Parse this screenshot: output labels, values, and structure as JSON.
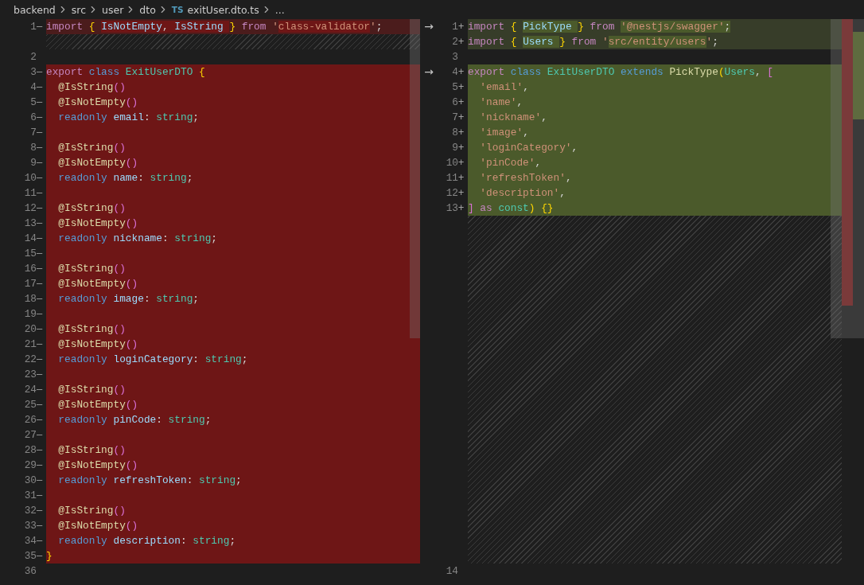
{
  "breadcrumb": [
    {
      "text": "backend"
    },
    {
      "text": "src"
    },
    {
      "text": "user"
    },
    {
      "text": "dto"
    },
    {
      "text": "exitUser.dto.ts",
      "badge": "TS"
    },
    {
      "text": "..."
    }
  ],
  "left_pane": {
    "rows": [
      {
        "kind": "modified",
        "number": "1",
        "marker": "—",
        "segments": [
          {
            "highlight": false,
            "tokens": [
              {
                "kind": "keyword",
                "text": "import "
              },
              {
                "kind": "bracket",
                "text": "{ "
              }
            ]
          },
          {
            "highlight": true,
            "tokens": [
              {
                "kind": "variable",
                "text": "IsNotEmpty"
              },
              {
                "kind": "punct",
                "text": ", "
              },
              {
                "kind": "variable",
                "text": "IsString "
              }
            ]
          },
          {
            "highlight": false,
            "tokens": [
              {
                "kind": "bracket",
                "text": "} "
              },
              {
                "kind": "keyword",
                "text": "from "
              },
              {
                "kind": "string",
                "text": "'"
              }
            ]
          },
          {
            "highlight": true,
            "tokens": [
              {
                "kind": "string",
                "text": "class-validator"
              }
            ]
          },
          {
            "highlight": false,
            "tokens": [
              {
                "kind": "string",
                "text": "'"
              },
              {
                "kind": "punct",
                "text": ";"
              }
            ]
          }
        ]
      },
      {
        "kind": "filler"
      },
      {
        "kind": "unchanged",
        "number": "2"
      },
      {
        "kind": "removed",
        "number": "3",
        "marker": "—",
        "tokens": [
          {
            "kind": "keyword",
            "text": "export "
          },
          {
            "kind": "storage",
            "text": "class "
          },
          {
            "kind": "type",
            "text": "ExitUserDTO "
          },
          {
            "kind": "bracket",
            "text": "{"
          }
        ]
      },
      {
        "kind": "removed",
        "number": "4",
        "marker": "—",
        "tokens": [
          {
            "kind": "function",
            "text": "  @IsString"
          },
          {
            "kind": "paren",
            "text": "()"
          }
        ]
      },
      {
        "kind": "removed",
        "number": "5",
        "marker": "—",
        "tokens": [
          {
            "kind": "function",
            "text": "  @IsNotEmpty"
          },
          {
            "kind": "paren",
            "text": "()"
          }
        ]
      },
      {
        "kind": "removed",
        "number": "6",
        "marker": "—",
        "tokens": [
          {
            "kind": "storage",
            "text": "  readonly "
          },
          {
            "kind": "variable",
            "text": "email"
          },
          {
            "kind": "punct",
            "text": ": "
          },
          {
            "kind": "type",
            "text": "string"
          },
          {
            "kind": "punct",
            "text": ";"
          }
        ]
      },
      {
        "kind": "removed",
        "number": "7",
        "marker": "—"
      },
      {
        "kind": "removed",
        "number": "8",
        "marker": "—",
        "tokens": [
          {
            "kind": "function",
            "text": "  @IsString"
          },
          {
            "kind": "paren",
            "text": "()"
          }
        ]
      },
      {
        "kind": "removed",
        "number": "9",
        "marker": "—",
        "tokens": [
          {
            "kind": "function",
            "text": "  @IsNotEmpty"
          },
          {
            "kind": "paren",
            "text": "()"
          }
        ]
      },
      {
        "kind": "removed",
        "number": "10",
        "marker": "—",
        "tokens": [
          {
            "kind": "storage",
            "text": "  readonly "
          },
          {
            "kind": "variable",
            "text": "name"
          },
          {
            "kind": "punct",
            "text": ": "
          },
          {
            "kind": "type",
            "text": "string"
          },
          {
            "kind": "punct",
            "text": ";"
          }
        ]
      },
      {
        "kind": "removed",
        "number": "11",
        "marker": "—"
      },
      {
        "kind": "removed",
        "number": "12",
        "marker": "—",
        "tokens": [
          {
            "kind": "function",
            "text": "  @IsString"
          },
          {
            "kind": "paren",
            "text": "()"
          }
        ]
      },
      {
        "kind": "removed",
        "number": "13",
        "marker": "—",
        "tokens": [
          {
            "kind": "function",
            "text": "  @IsNotEmpty"
          },
          {
            "kind": "paren",
            "text": "()"
          }
        ]
      },
      {
        "kind": "removed",
        "number": "14",
        "marker": "—",
        "tokens": [
          {
            "kind": "storage",
            "text": "  readonly "
          },
          {
            "kind": "variable",
            "text": "nickname"
          },
          {
            "kind": "punct",
            "text": ": "
          },
          {
            "kind": "type",
            "text": "string"
          },
          {
            "kind": "punct",
            "text": ";"
          }
        ]
      },
      {
        "kind": "removed",
        "number": "15",
        "marker": "—"
      },
      {
        "kind": "removed",
        "number": "16",
        "marker": "—",
        "tokens": [
          {
            "kind": "function",
            "text": "  @IsString"
          },
          {
            "kind": "paren",
            "text": "()"
          }
        ]
      },
      {
        "kind": "removed",
        "number": "17",
        "marker": "—",
        "tokens": [
          {
            "kind": "function",
            "text": "  @IsNotEmpty"
          },
          {
            "kind": "paren",
            "text": "()"
          }
        ]
      },
      {
        "kind": "removed",
        "number": "18",
        "marker": "—",
        "tokens": [
          {
            "kind": "storage",
            "text": "  readonly "
          },
          {
            "kind": "variable",
            "text": "image"
          },
          {
            "kind": "punct",
            "text": ": "
          },
          {
            "kind": "type",
            "text": "string"
          },
          {
            "kind": "punct",
            "text": ";"
          }
        ]
      },
      {
        "kind": "removed",
        "number": "19",
        "marker": "—"
      },
      {
        "kind": "removed",
        "number": "20",
        "marker": "—",
        "tokens": [
          {
            "kind": "function",
            "text": "  @IsString"
          },
          {
            "kind": "paren",
            "text": "()"
          }
        ]
      },
      {
        "kind": "removed",
        "number": "21",
        "marker": "—",
        "tokens": [
          {
            "kind": "function",
            "text": "  @IsNotEmpty"
          },
          {
            "kind": "paren",
            "text": "()"
          }
        ]
      },
      {
        "kind": "removed",
        "number": "22",
        "marker": "—",
        "tokens": [
          {
            "kind": "storage",
            "text": "  readonly "
          },
          {
            "kind": "variable",
            "text": "loginCategory"
          },
          {
            "kind": "punct",
            "text": ": "
          },
          {
            "kind": "type",
            "text": "string"
          },
          {
            "kind": "punct",
            "text": ";"
          }
        ]
      },
      {
        "kind": "removed",
        "number": "23",
        "marker": "—"
      },
      {
        "kind": "removed",
        "number": "24",
        "marker": "—",
        "tokens": [
          {
            "kind": "function",
            "text": "  @IsString"
          },
          {
            "kind": "paren",
            "text": "()"
          }
        ]
      },
      {
        "kind": "removed",
        "number": "25",
        "marker": "—",
        "tokens": [
          {
            "kind": "function",
            "text": "  @IsNotEmpty"
          },
          {
            "kind": "paren",
            "text": "()"
          }
        ]
      },
      {
        "kind": "removed",
        "number": "26",
        "marker": "—",
        "tokens": [
          {
            "kind": "storage",
            "text": "  readonly "
          },
          {
            "kind": "variable",
            "text": "pinCode"
          },
          {
            "kind": "punct",
            "text": ": "
          },
          {
            "kind": "type",
            "text": "string"
          },
          {
            "kind": "punct",
            "text": ";"
          }
        ]
      },
      {
        "kind": "removed",
        "number": "27",
        "marker": "—"
      },
      {
        "kind": "removed",
        "number": "28",
        "marker": "—",
        "tokens": [
          {
            "kind": "function",
            "text": "  @IsString"
          },
          {
            "kind": "paren",
            "text": "()"
          }
        ]
      },
      {
        "kind": "removed",
        "number": "29",
        "marker": "—",
        "tokens": [
          {
            "kind": "function",
            "text": "  @IsNotEmpty"
          },
          {
            "kind": "paren",
            "text": "()"
          }
        ]
      },
      {
        "kind": "removed",
        "number": "30",
        "marker": "—",
        "tokens": [
          {
            "kind": "storage",
            "text": "  readonly "
          },
          {
            "kind": "variable",
            "text": "refreshToken"
          },
          {
            "kind": "punct",
            "text": ": "
          },
          {
            "kind": "type",
            "text": "string"
          },
          {
            "kind": "punct",
            "text": ";"
          }
        ]
      },
      {
        "kind": "removed",
        "number": "31",
        "marker": "—"
      },
      {
        "kind": "removed",
        "number": "32",
        "marker": "—",
        "tokens": [
          {
            "kind": "function",
            "text": "  @IsString"
          },
          {
            "kind": "paren",
            "text": "()"
          }
        ]
      },
      {
        "kind": "removed",
        "number": "33",
        "marker": "—",
        "tokens": [
          {
            "kind": "function",
            "text": "  @IsNotEmpty"
          },
          {
            "kind": "paren",
            "text": "()"
          }
        ]
      },
      {
        "kind": "removed",
        "number": "34",
        "marker": "—",
        "tokens": [
          {
            "kind": "storage",
            "text": "  readonly "
          },
          {
            "kind": "variable",
            "text": "description"
          },
          {
            "kind": "punct",
            "text": ": "
          },
          {
            "kind": "type",
            "text": "string"
          },
          {
            "kind": "punct",
            "text": ";"
          }
        ]
      },
      {
        "kind": "removed",
        "number": "35",
        "marker": "—",
        "tokens": [
          {
            "kind": "bracket",
            "text": "}"
          }
        ]
      },
      {
        "kind": "unchanged",
        "number": "36"
      }
    ]
  },
  "right_pane": {
    "rows": [
      {
        "kind": "modified",
        "number": "1",
        "marker": "+",
        "arrow": "→",
        "segments": [
          {
            "highlight": false,
            "tokens": [
              {
                "kind": "keyword",
                "text": "import "
              },
              {
                "kind": "bracket",
                "text": "{ "
              }
            ]
          },
          {
            "highlight": true,
            "tokens": [
              {
                "kind": "variable",
                "text": "PickType "
              }
            ]
          },
          {
            "highlight": false,
            "tokens": [
              {
                "kind": "bracket",
                "text": "} "
              },
              {
                "kind": "keyword",
                "text": "from "
              }
            ]
          },
          {
            "highlight": true,
            "tokens": [
              {
                "kind": "string",
                "text": "'@nestjs/swagger'"
              },
              {
                "kind": "punct",
                "text": ";"
              }
            ]
          }
        ]
      },
      {
        "kind": "modified",
        "number": "2",
        "marker": "+",
        "segments": [
          {
            "highlight": false,
            "tokens": [
              {
                "kind": "keyword",
                "text": "import "
              },
              {
                "kind": "bracket",
                "text": "{ "
              }
            ]
          },
          {
            "highlight": true,
            "tokens": [
              {
                "kind": "variable",
                "text": "Users "
              }
            ]
          },
          {
            "highlight": false,
            "tokens": [
              {
                "kind": "bracket",
                "text": "} "
              },
              {
                "kind": "keyword",
                "text": "from "
              },
              {
                "kind": "string",
                "text": "'"
              }
            ]
          },
          {
            "highlight": true,
            "tokens": [
              {
                "kind": "string",
                "text": "src/entity/users"
              }
            ]
          },
          {
            "highlight": false,
            "tokens": [
              {
                "kind": "string",
                "text": "'"
              },
              {
                "kind": "punct",
                "text": ";"
              }
            ]
          }
        ]
      },
      {
        "kind": "unchanged",
        "number": "3"
      },
      {
        "kind": "added",
        "number": "4",
        "marker": "+",
        "arrow": "→",
        "tokens": [
          {
            "kind": "keyword",
            "text": "export "
          },
          {
            "kind": "storage",
            "text": "class "
          },
          {
            "kind": "type",
            "text": "ExitUserDTO "
          },
          {
            "kind": "storage",
            "text": "extends "
          },
          {
            "kind": "function",
            "text": "PickType"
          },
          {
            "kind": "bracket",
            "text": "("
          },
          {
            "kind": "type",
            "text": "Users"
          },
          {
            "kind": "punct",
            "text": ", "
          },
          {
            "kind": "paren",
            "text": "["
          }
        ]
      },
      {
        "kind": "added",
        "number": "5",
        "marker": "+",
        "tokens": [
          {
            "kind": "string",
            "text": "  'email'"
          },
          {
            "kind": "punct",
            "text": ","
          }
        ]
      },
      {
        "kind": "added",
        "number": "6",
        "marker": "+",
        "tokens": [
          {
            "kind": "string",
            "text": "  'name'"
          },
          {
            "kind": "punct",
            "text": ","
          }
        ]
      },
      {
        "kind": "added",
        "number": "7",
        "marker": "+",
        "tokens": [
          {
            "kind": "string",
            "text": "  'nickname'"
          },
          {
            "kind": "punct",
            "text": ","
          }
        ]
      },
      {
        "kind": "added",
        "number": "8",
        "marker": "+",
        "tokens": [
          {
            "kind": "string",
            "text": "  'image'"
          },
          {
            "kind": "punct",
            "text": ","
          }
        ]
      },
      {
        "kind": "added",
        "number": "9",
        "marker": "+",
        "tokens": [
          {
            "kind": "string",
            "text": "  'loginCategory'"
          },
          {
            "kind": "punct",
            "text": ","
          }
        ]
      },
      {
        "kind": "added",
        "number": "10",
        "marker": "+",
        "tokens": [
          {
            "kind": "string",
            "text": "  'pinCode'"
          },
          {
            "kind": "punct",
            "text": ","
          }
        ]
      },
      {
        "kind": "added",
        "number": "11",
        "marker": "+",
        "tokens": [
          {
            "kind": "string",
            "text": "  'refreshToken'"
          },
          {
            "kind": "punct",
            "text": ","
          }
        ]
      },
      {
        "kind": "added",
        "number": "12",
        "marker": "+",
        "tokens": [
          {
            "kind": "string",
            "text": "  'description'"
          },
          {
            "kind": "punct",
            "text": ","
          }
        ]
      },
      {
        "kind": "added",
        "number": "13",
        "marker": "+",
        "tokens": [
          {
            "kind": "paren",
            "text": "] "
          },
          {
            "kind": "keyword",
            "text": "as "
          },
          {
            "kind": "type",
            "text": "const"
          },
          {
            "kind": "bracket",
            "text": ")"
          },
          {
            "kind": "bracket",
            "text": " {}"
          }
        ]
      },
      {
        "kind": "filler"
      },
      {
        "kind": "unchanged",
        "number": "14"
      }
    ]
  }
}
